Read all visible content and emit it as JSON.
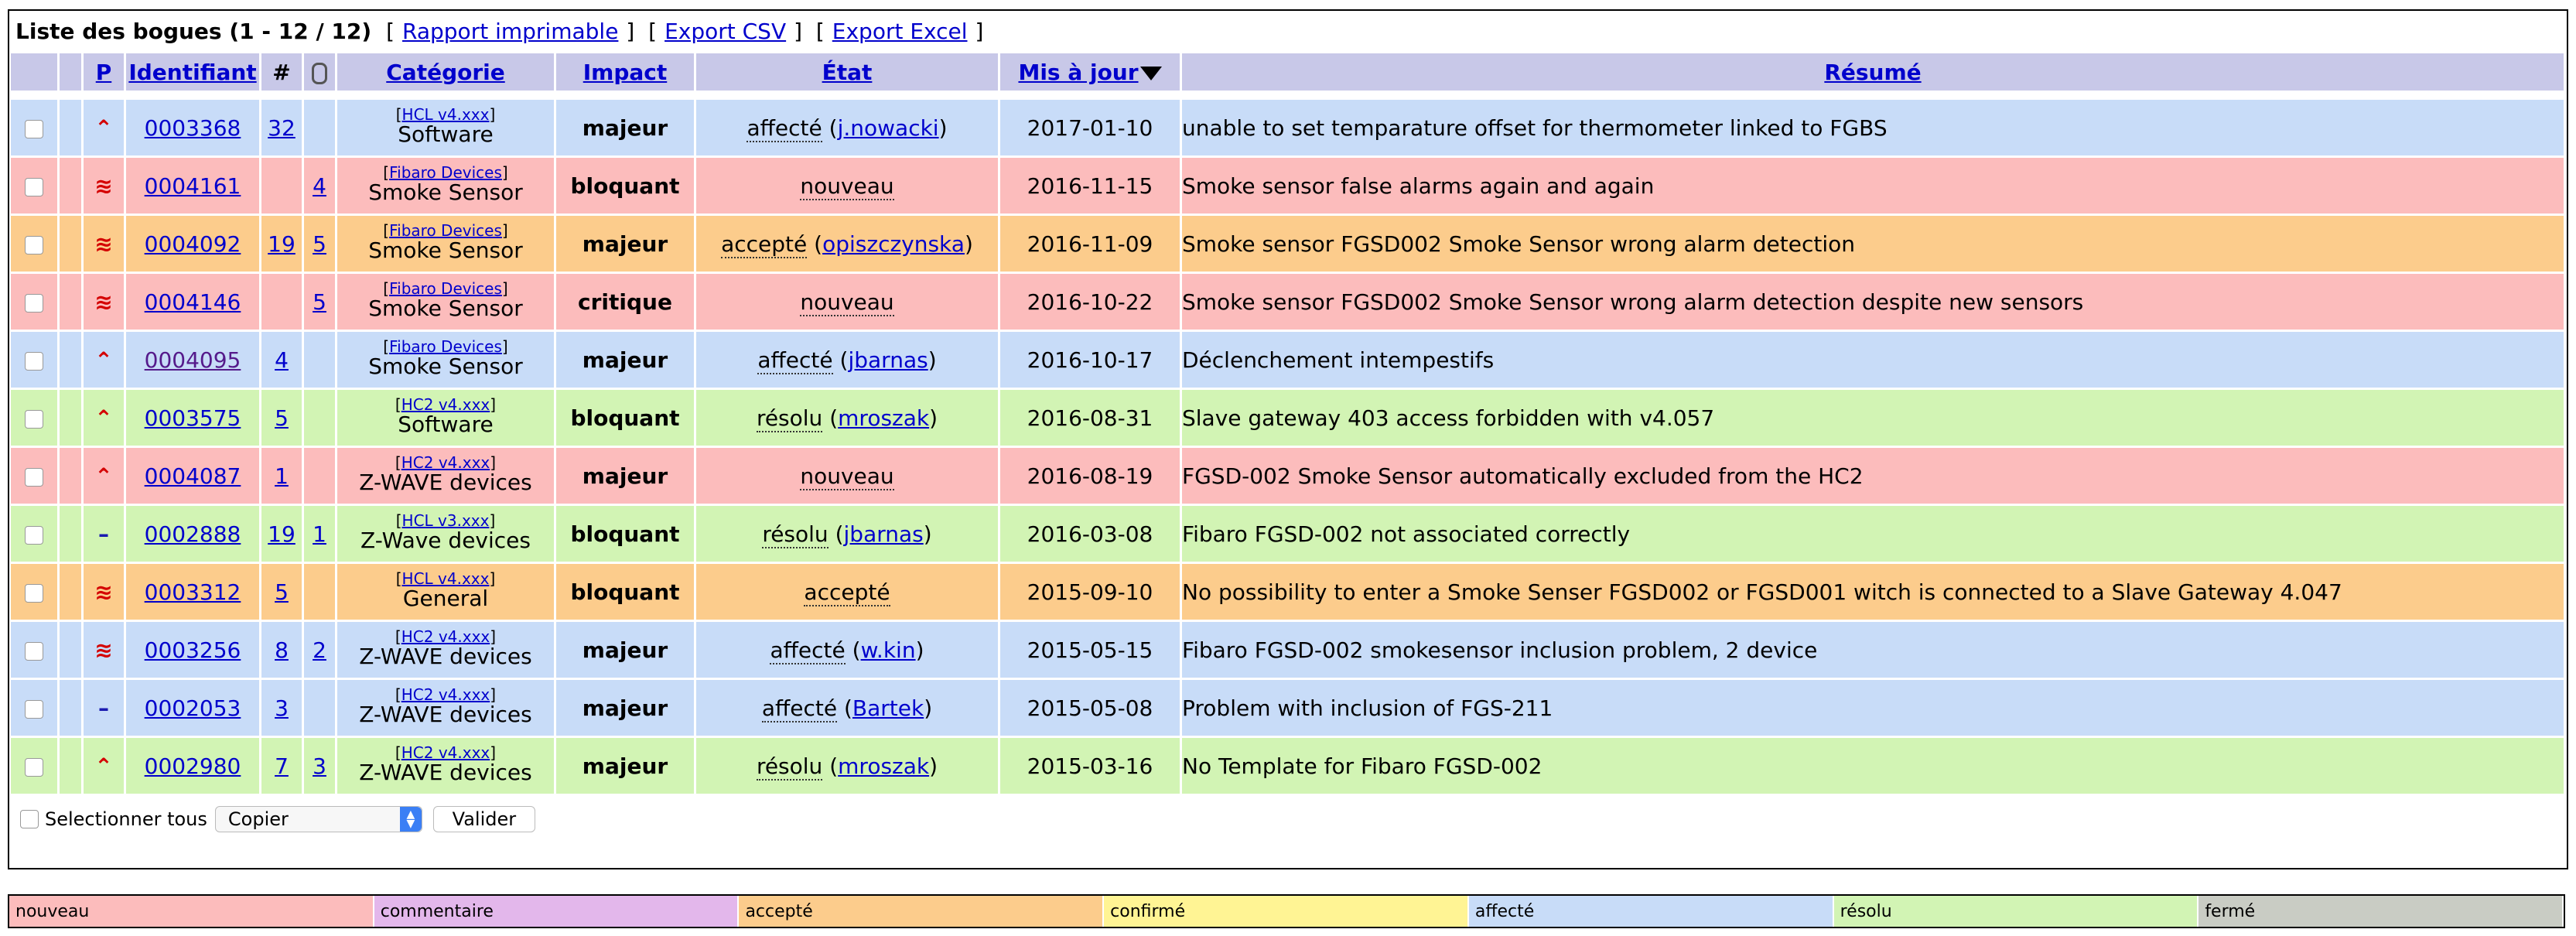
{
  "header": {
    "title": "Liste des bogues (1 - 12 / 12)",
    "links": [
      "Rapport imprimable",
      "Export CSV",
      "Export Excel"
    ]
  },
  "columns": {
    "p": "P",
    "id": "Identifiant",
    "notes": "#",
    "attachments_icon": "paperclip-icon",
    "category": "Catégorie",
    "impact": "Impact",
    "state": "État",
    "updated": "Mis à jour",
    "summary": "Résumé"
  },
  "rows": [
    {
      "priority": "high",
      "priority_glyph": "⌃",
      "id": "0003368",
      "notes": "32",
      "files": "",
      "project": "HCL v4.xxx",
      "category": "Software",
      "impact": "majeur",
      "state": "affecté",
      "handler": "j.nowacki",
      "date": "2017-01-10",
      "summary": "unable to set temparature offset for thermometer linked to FGBS",
      "color": "#c8dcf8"
    },
    {
      "priority": "urgent",
      "priority_glyph": "≋",
      "id": "0004161",
      "notes": "",
      "files": "4",
      "project": "Fibaro Devices",
      "category": "Smoke Sensor",
      "impact": "bloquant",
      "state": "nouveau",
      "handler": "",
      "date": "2016-11-15",
      "summary": "Smoke sensor false alarms again and again",
      "color": "#fcbcbc"
    },
    {
      "priority": "urgent",
      "priority_glyph": "≋",
      "id": "0004092",
      "notes": "19",
      "files": "5",
      "project": "Fibaro Devices",
      "category": "Smoke Sensor",
      "impact": "majeur",
      "state": "accepté",
      "handler": "opiszczynska",
      "date": "2016-11-09",
      "summary": "Smoke sensor FGSD002 Smoke Sensor wrong alarm detection",
      "color": "#fccc8c"
    },
    {
      "priority": "urgent",
      "priority_glyph": "≋",
      "id": "0004146",
      "notes": "",
      "files": "5",
      "project": "Fibaro Devices",
      "category": "Smoke Sensor",
      "impact": "critique",
      "state": "nouveau",
      "handler": "",
      "date": "2016-10-22",
      "summary": "Smoke sensor FGSD002 Smoke Sensor wrong alarm detection despite new sensors",
      "color": "#fcbcbc"
    },
    {
      "priority": "high",
      "priority_glyph": "⌃",
      "id": "0004095",
      "notes": "4",
      "files": "",
      "project": "Fibaro Devices",
      "category": "Smoke Sensor",
      "impact": "majeur",
      "state": "affecté",
      "handler": "jbarnas",
      "date": "2016-10-17",
      "summary": "Déclenchement intempestifs",
      "color": "#c8dcf8"
    },
    {
      "priority": "high",
      "priority_glyph": "⌃",
      "id": "0003575",
      "notes": "5",
      "files": "",
      "project": "HC2 v4.xxx",
      "category": "Software",
      "impact": "bloquant",
      "state": "résolu",
      "handler": "mroszak",
      "date": "2016-08-31",
      "summary": "Slave gateway 403 access forbidden with v4.057",
      "color": "#d2f4b4"
    },
    {
      "priority": "high",
      "priority_glyph": "⌃",
      "id": "0004087",
      "notes": "1",
      "files": "",
      "project": "HC2 v4.xxx",
      "category": "Z-WAVE devices",
      "impact": "majeur",
      "state": "nouveau",
      "handler": "",
      "date": "2016-08-19",
      "summary": "FGSD-002 Smoke Sensor automatically excluded from the HC2",
      "color": "#fcbcbc"
    },
    {
      "priority": "normal",
      "priority_glyph": "–",
      "id": "0002888",
      "notes": "19",
      "files": "1",
      "project": "HCL v3.xxx",
      "category": "Z-Wave devices",
      "impact": "bloquant",
      "state": "résolu",
      "handler": "jbarnas",
      "date": "2016-03-08",
      "summary": "Fibaro FGSD-002 not associated correctly",
      "color": "#d2f4b4"
    },
    {
      "priority": "urgent",
      "priority_glyph": "≋",
      "id": "0003312",
      "notes": "5",
      "files": "",
      "project": "HCL v4.xxx",
      "category": "General",
      "impact": "bloquant",
      "state": "accepté",
      "handler": "",
      "date": "2015-09-10",
      "summary": "No possibility to enter a Smoke Senser FGSD002 or FGSD001 witch is connected to a Slave Gateway 4.047",
      "color": "#fccc8c"
    },
    {
      "priority": "urgent",
      "priority_glyph": "≋",
      "id": "0003256",
      "notes": "8",
      "files": "2",
      "project": "HC2 v4.xxx",
      "category": "Z-WAVE devices",
      "impact": "majeur",
      "state": "affecté",
      "handler": "w.kin",
      "date": "2015-05-15",
      "summary": "Fibaro FGSD-002 smokesensor inclusion problem, 2 device",
      "color": "#c8dcf8"
    },
    {
      "priority": "normal",
      "priority_glyph": "–",
      "id": "0002053",
      "notes": "3",
      "files": "",
      "project": "HC2 v4.xxx",
      "category": "Z-WAVE devices",
      "impact": "majeur",
      "state": "affecté",
      "handler": "Bartek",
      "date": "2015-05-08",
      "summary": "Problem with inclusion of FGS-211",
      "color": "#c8dcf8"
    },
    {
      "priority": "high",
      "priority_glyph": "⌃",
      "id": "0002980",
      "notes": "7",
      "files": "3",
      "project": "HC2 v4.xxx",
      "category": "Z-WAVE devices",
      "impact": "majeur",
      "state": "résolu",
      "handler": "mroszak",
      "date": "2015-03-16",
      "summary": "No Template for Fibaro FGSD-002",
      "color": "#d2f4b4"
    }
  ],
  "footer": {
    "select_all": "Selectionner tous",
    "action_select": "Copier",
    "submit": "Valider"
  },
  "legend": [
    {
      "label": "nouveau",
      "color": "#fcbcbc"
    },
    {
      "label": "commentaire",
      "color": "#e3b7eb"
    },
    {
      "label": "accepté",
      "color": "#fccc8c"
    },
    {
      "label": "confirmé",
      "color": "#fff494"
    },
    {
      "label": "affecté",
      "color": "#c8dcf8"
    },
    {
      "label": "résolu",
      "color": "#d2f4b4"
    },
    {
      "label": "fermé",
      "color": "#c9ccc4"
    }
  ]
}
